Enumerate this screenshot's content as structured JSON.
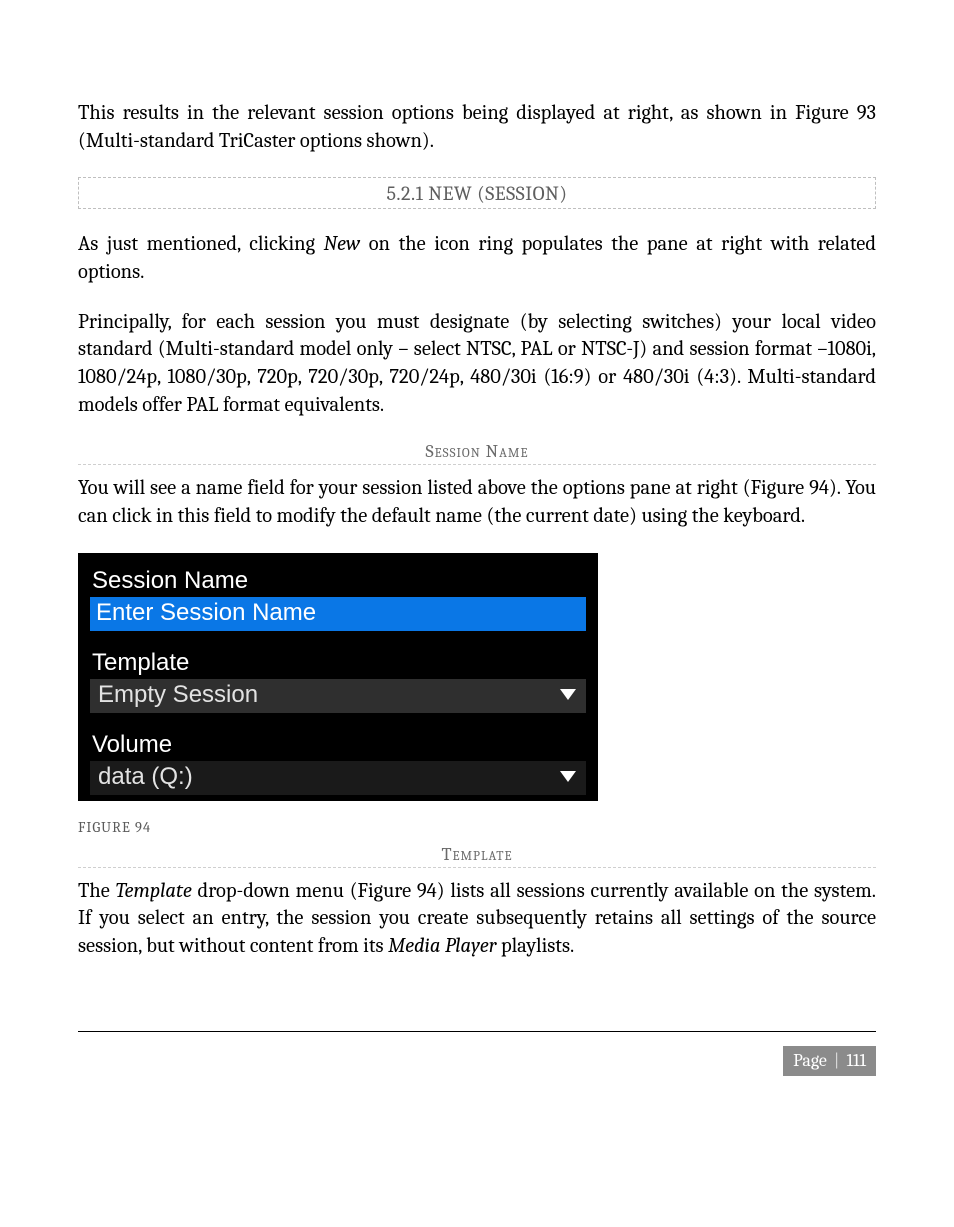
{
  "intro_para_pre": "This results in the relevant session options being displayed at right, as shown in ",
  "intro_para_post": "Figure 93 (Multi-standard TriCaster options shown).",
  "section_heading": "5.2.1 NEW (SESSION)",
  "p2_a": "As just mentioned, clicking ",
  "p2_new": "New",
  "p2_b": " on the icon ring populates the pane at right with related options.",
  "p3": "Principally, for each session you must designate (by selecting switches) your local video standard (Multi-standard model only – select NTSC, PAL or NTSC-J) and session format –1080i, 1080/24p, 1080/30p, 720p, 720/30p, 720/24p, 480/30i (16:9) or 480/30i (4:3). Multi-standard models offer PAL format equivalents.",
  "sub1": "Session Name",
  "p4": "You will see a name field for your session listed above the options pane at right (Figure 94).  You can click in this field to modify the default name (the current date) using the keyboard.",
  "ui": {
    "session_name_label": "Session Name",
    "session_name_value": "Enter Session Name",
    "template_label": "Template",
    "template_value": "Empty Session",
    "volume_label": "Volume",
    "volume_value": "data   (Q:)"
  },
  "figure_caption": "FIGURE 94",
  "sub2": "Template",
  "p5_a": "The ",
  "p5_template": "Template",
  "p5_b": " drop-down menu (Figure 94) lists all sessions currently available on the system. If you select an entry, the session you create subsequently retains all settings of the source session, but without content from its ",
  "p5_mp": "Media Player",
  "p5_c": " playlists.",
  "footer_label": "Page",
  "footer_num": "111"
}
